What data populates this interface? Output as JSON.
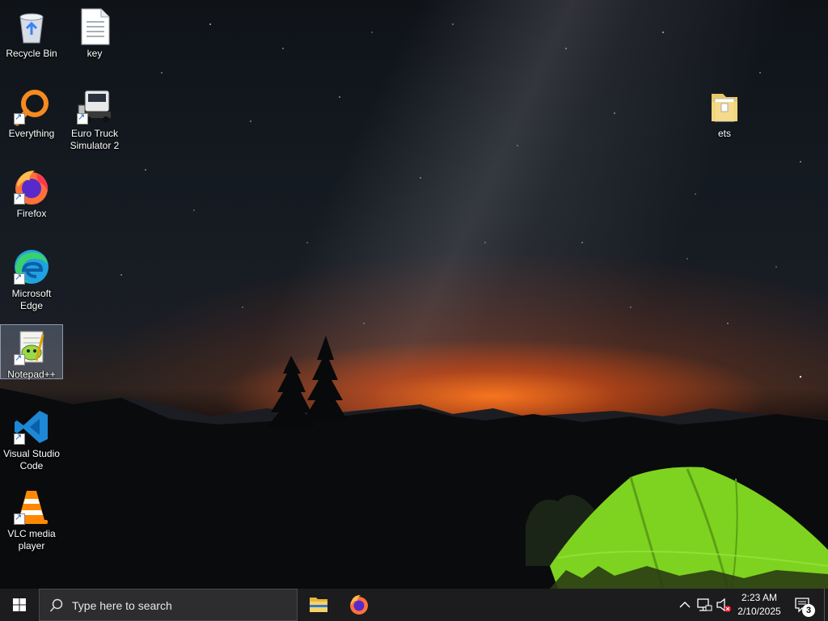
{
  "desktop": {
    "icons": [
      {
        "label": "Recycle Bin",
        "icon": "recycle-bin-icon"
      },
      {
        "label": "key",
        "icon": "text-file-icon"
      },
      {
        "label": "Everything",
        "icon": "everything-search-icon"
      },
      {
        "label": "Euro Truck Simulator 2",
        "icon": "truck-icon"
      },
      {
        "label": "ets",
        "icon": "folder-icon"
      },
      {
        "label": "Firefox",
        "icon": "firefox-icon"
      },
      {
        "label": "Microsoft Edge",
        "icon": "edge-icon"
      },
      {
        "label": "Notepad++",
        "icon": "notepad-plus-plus-icon"
      },
      {
        "label": "Visual Studio Code",
        "icon": "vscode-icon"
      },
      {
        "label": "VLC media player",
        "icon": "vlc-icon"
      }
    ],
    "selected_icon": "Notepad++"
  },
  "taskbar": {
    "search_placeholder": "Type here to search",
    "pinned": [
      {
        "name": "File Explorer",
        "icon": "file-explorer-icon"
      },
      {
        "name": "Firefox",
        "icon": "firefox-icon"
      }
    ],
    "tray": {
      "time": "2:23 AM",
      "date": "2/10/2025",
      "notification_count": "3",
      "volume_muted": true
    }
  },
  "colors": {
    "taskbar_bg": "#1c1c1e",
    "search_bg": "#2d2d30",
    "accent_tent": "#7ed321"
  }
}
